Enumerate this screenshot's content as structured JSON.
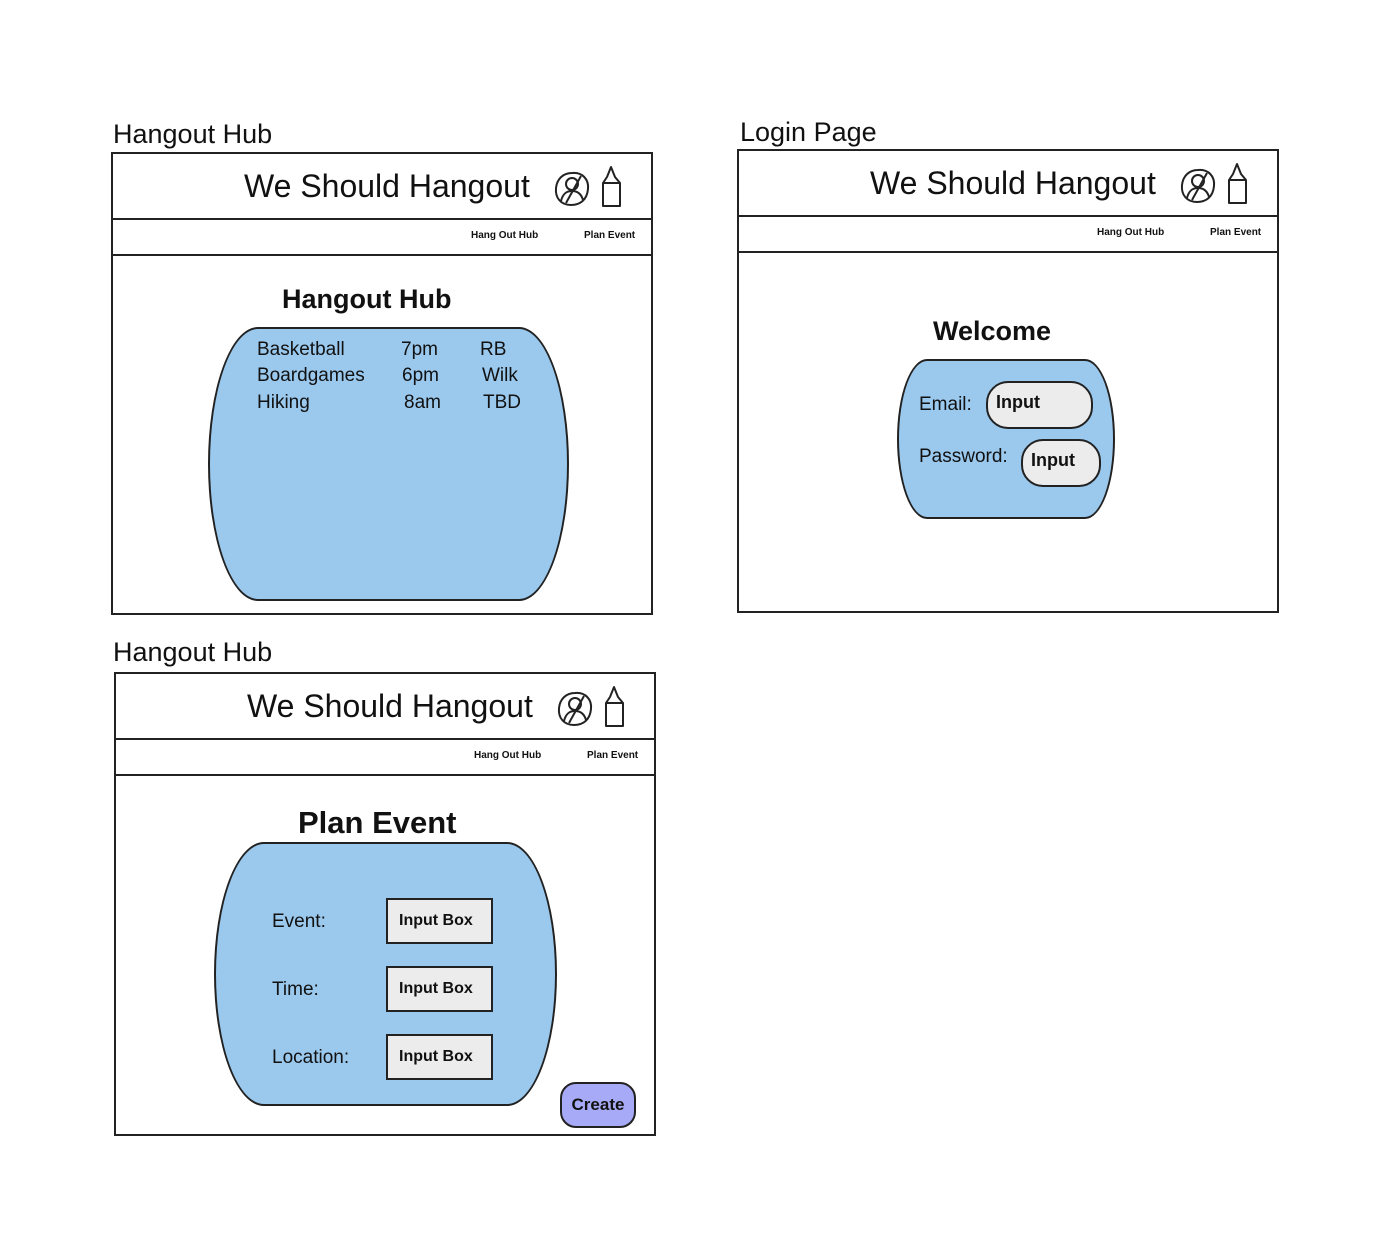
{
  "app": {
    "title": "We Should Hangout"
  },
  "nav": {
    "hangout_hub": "Hang Out Hub",
    "plan_event": "Plan Event"
  },
  "icons": {
    "profile": "user-profile-icon",
    "bottle": "bottle-icon"
  },
  "colors": {
    "panel_blue": "#9bc9ee",
    "input_gray": "#ececec",
    "create_button": "#a7aaf7"
  },
  "frames": {
    "hub": {
      "caption": "Hangout Hub",
      "heading": "Hangout Hub",
      "events": [
        {
          "name": "Basketball",
          "time": "7pm",
          "host": "RB"
        },
        {
          "name": "Boardgames",
          "time": "6pm",
          "host": "Wilk"
        },
        {
          "name": "Hiking",
          "time": "8am",
          "host": "TBD"
        }
      ]
    },
    "login": {
      "caption": "Login Page",
      "heading": "Welcome",
      "email_label": "Email:",
      "email_input": "Input",
      "password_label": "Password:",
      "password_input": "Input"
    },
    "plan": {
      "caption": "Hangout Hub",
      "heading": "Plan Event",
      "event_label": "Event:",
      "time_label": "Time:",
      "location_label": "Location:",
      "input_text": "Input Box",
      "create_label": "Create"
    }
  }
}
